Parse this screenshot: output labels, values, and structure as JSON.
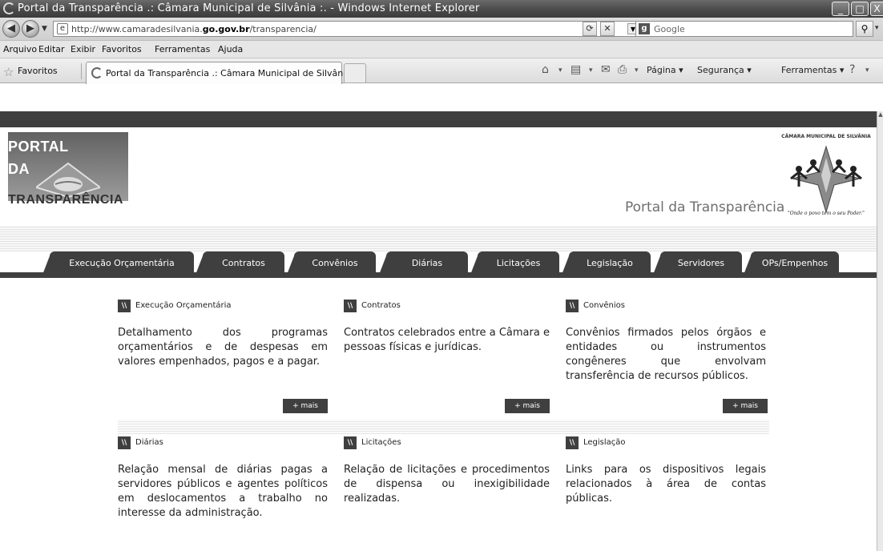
{
  "window": {
    "title": "Portal da Transparência .: Câmara Municipal de Silvânia :. - Windows Internet Explorer",
    "buttons": {
      "minimize": "_",
      "maximize": "□",
      "close": "X"
    }
  },
  "address_bar": {
    "url_prefix": "http://www.camaradesilvania.",
    "url_bold": "go.gov.br",
    "url_suffix": "/transparencia/",
    "search_placeholder": "Google"
  },
  "menu": {
    "items": [
      "Arquivo",
      "Editar",
      "Exibir",
      "Favoritos",
      "Ferramentas",
      "Ajuda"
    ]
  },
  "favorites_bar": {
    "favorites_label": "Favoritos",
    "tab_title": "Portal da Transparência .: Câmara Municipal de Silvâni...",
    "commands": {
      "pagina": "Página",
      "seguranca": "Segurança",
      "ferramentas": "Ferramentas"
    }
  },
  "header": {
    "logo_line1": "PORTAL",
    "logo_line2": "DA",
    "logo_line3": "TRANSPARÊNCIA",
    "right_title": "Portal da Transparência",
    "camara_name": "CÂMARA MUNICIPAL DE SILVÂNIA",
    "camara_slogan": "\"Onde o povo tem o seu Poder.\""
  },
  "nav_tabs": [
    "Execução Orçamentária",
    "Contratos",
    "Convênios",
    "Diárias",
    "Licitações",
    "Legislação",
    "Servidores",
    "OPs/Empenhos"
  ],
  "cards": [
    {
      "title": "Execução Orçamentária",
      "body": "Detalhamento dos programas orçamentários e de despesas em valores empenhados, pagos e a pagar.",
      "more": "+ mais"
    },
    {
      "title": "Contratos",
      "body": "Contratos celebrados entre a Câmara e pessoas físicas e jurídicas.",
      "more": "+ mais"
    },
    {
      "title": "Convênios",
      "body": "Convênios firmados pelos órgãos e entidades ou instrumentos congêneres que envolvam transferência de recursos públicos.",
      "more": "+ mais"
    },
    {
      "title": "Diárias",
      "body": "Relação mensal de diárias pagas a servidores públicos e agentes políticos em deslocamentos a trabalho no interesse da administração."
    },
    {
      "title": "Licitações",
      "body": "Relação de licitações e procedimentos de dispensa ou inexigibilidade realizadas."
    },
    {
      "title": "Legislação",
      "body": "Links para os dispositivos legais relacionados à área de contas públicas."
    }
  ]
}
